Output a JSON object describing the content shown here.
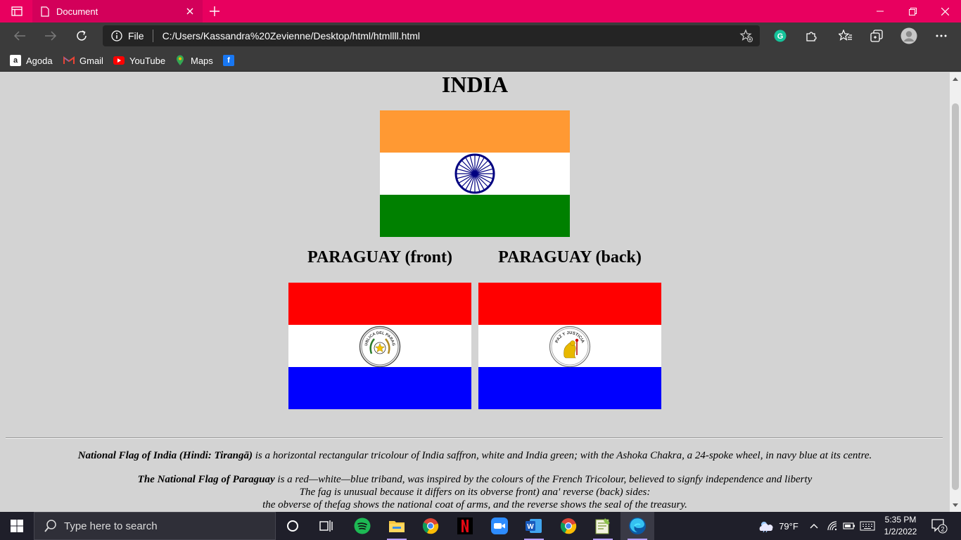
{
  "browser": {
    "tab_title": "Document",
    "address_scheme": "File",
    "address_url": "C:/Users/Kassandra%20Zevienne/Desktop/html/htmllll.html",
    "bookmarks": [
      "Agoda",
      "Gmail",
      "YouTube",
      "Maps",
      ""
    ]
  },
  "page": {
    "india_heading": "INDIA",
    "paraguay_front_caption": "PARAGUAY (front)",
    "paraguay_back_caption": "PARAGUAY (back)",
    "front_seal_text": "REPUBLICA DEL PARAGUAY",
    "back_seal_text": "PAZ Y JUSTICIA",
    "india_desc_bold": "National Flag of India (Hindi: Tirangā)",
    "india_desc_rest": " is a horizontal rectangular tricolour of India saffron, white and India green; with the Ashoka Chakra, a 24-spoke wheel, in navy blue at its centre.",
    "paraguay_desc_bold": "The National Flag of Paraguay",
    "paraguay_desc_rest": " is a red—white—blue triband, was inspired by the colours of the French Tricolour, believed to signfy independence and liberty",
    "paraguay_line2": "The fag is unusual because it differs on its obverse front) ana' reverse (back) sides:",
    "paraguay_line3": "the obverse of thefag shows the national coat of arms, and the reverse shows the seal of the treasury."
  },
  "colors": {
    "titlebar": "#e8005f",
    "india_saffron": "#ff9933",
    "india_white": "#ffffff",
    "india_green": "#008000",
    "chakra_navy": "#000080",
    "paraguay_red": "#ff0000",
    "paraguay_white": "#ffffff",
    "paraguay_blue": "#0000ff"
  },
  "taskbar": {
    "search_placeholder": "Type here to search",
    "weather": "79°F",
    "time": "5:35 PM",
    "date": "1/2/2022",
    "notification_count": "2"
  }
}
